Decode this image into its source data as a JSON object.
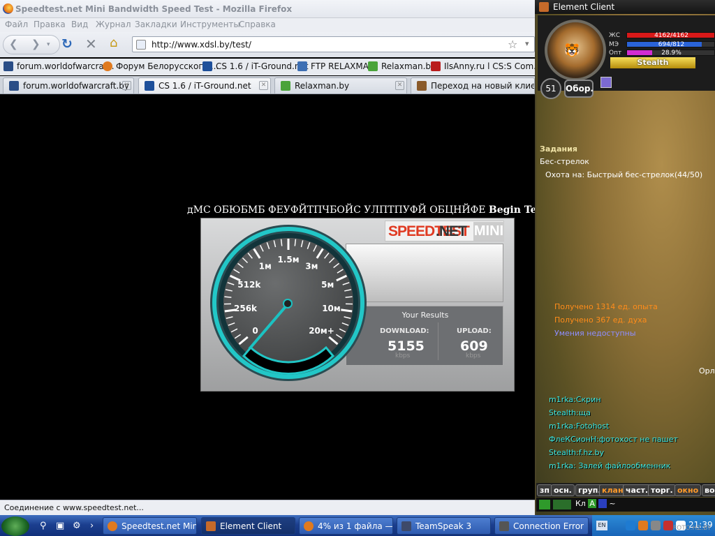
{
  "firefox": {
    "title": "Speedtest.net Mini Bandwidth Speed Test - Mozilla Firefox",
    "menu": [
      "Файл",
      "Правка",
      "Вид",
      "Журнал",
      "Закладки",
      "Инструменты",
      "Справка"
    ],
    "url": "http://www.xdsl.by/test/",
    "bookmarks": [
      "forum.worldofwarcraf...",
      "Форум Белорусского ...",
      "CS 1.6 / iT-Ground.net",
      "FTP RELAXMAN",
      "Relaxman.by",
      "IlsAnny.ru l CS:S Com..."
    ],
    "tabs": [
      "forum.worldofwarcraft.by",
      "CS 1.6 / iT-Ground.net",
      "Relaxman.by",
      "Переход на новый клиент..."
    ],
    "status": "Соединение с www.speedtest.net..."
  },
  "page": {
    "headline": "дМС ОБЮБМБ ФЕУФЙТПЧБОЙС УЛПТПУФЙ ОБЦНЙФЕ",
    "begin_test": "Begin Test"
  },
  "speedtest": {
    "logo_a": "SPEEDTEST",
    "logo_b": ".NET",
    "logo_c": "MINI",
    "results_title": "Your Results",
    "download_label": "DOWNLOAD:",
    "download_value": "5155",
    "download_unit": "kbps",
    "upload_label": "UPLOAD:",
    "upload_value": "609",
    "upload_unit": "kbps",
    "gauge_labels": [
      "0",
      "256k",
      "512k",
      "1м",
      "1.5м",
      "3м",
      "5м",
      "10м",
      "20м+"
    ]
  },
  "game": {
    "title": "Element Client",
    "portrait": "TIGER",
    "hp_label": "ЖС",
    "hp": "4162/4162",
    "hp_fraction": 1,
    "mp_label": "МЭ",
    "mp": "694/812",
    "mp_fraction": 0.855,
    "xp_label": "Опт",
    "xp": "28.9%",
    "xp_fraction": 0.289,
    "stealth": "Stealth",
    "level": "51",
    "mode": "Обор.",
    "quest_header": "Задания",
    "quest_name": "Бес-стрелок",
    "quest_task": "Охота на: Быстрый бес-стрелок(44/50)",
    "sys": [
      "Получено 1314 ед. опыта",
      "Получено 367 ед. духа",
      "Умения недоступны"
    ],
    "chat": [
      "m1rka:Скрин",
      "Stealth:ща",
      "m1rka:Fotohost",
      "ФлеКСионН:фотохост не пашет",
      "Stealth:f.hz.by",
      "m1rka: Залей файлообменник"
    ],
    "orl": "Орл",
    "channels": [
      "зп",
      "осн.",
      "груп.",
      "клан",
      "част.",
      "торг.",
      "окно",
      "во"
    ],
    "input_mode": "Кл",
    "input_a": "A"
  },
  "taskbar": {
    "tasks": [
      "Speedtest.net Min...",
      "Element Client",
      "4% из 1 файла —...",
      "TeamSpeak 3",
      "Connection Error"
    ],
    "lang": "EN",
    "clock": "21:39"
  },
  "watermark": "FOTO.HZ.BY",
  "colors": {
    "hp": "#d81919",
    "mp": "#2a63d8",
    "xp": "#d22cd2",
    "accent": "#19c8c8"
  }
}
